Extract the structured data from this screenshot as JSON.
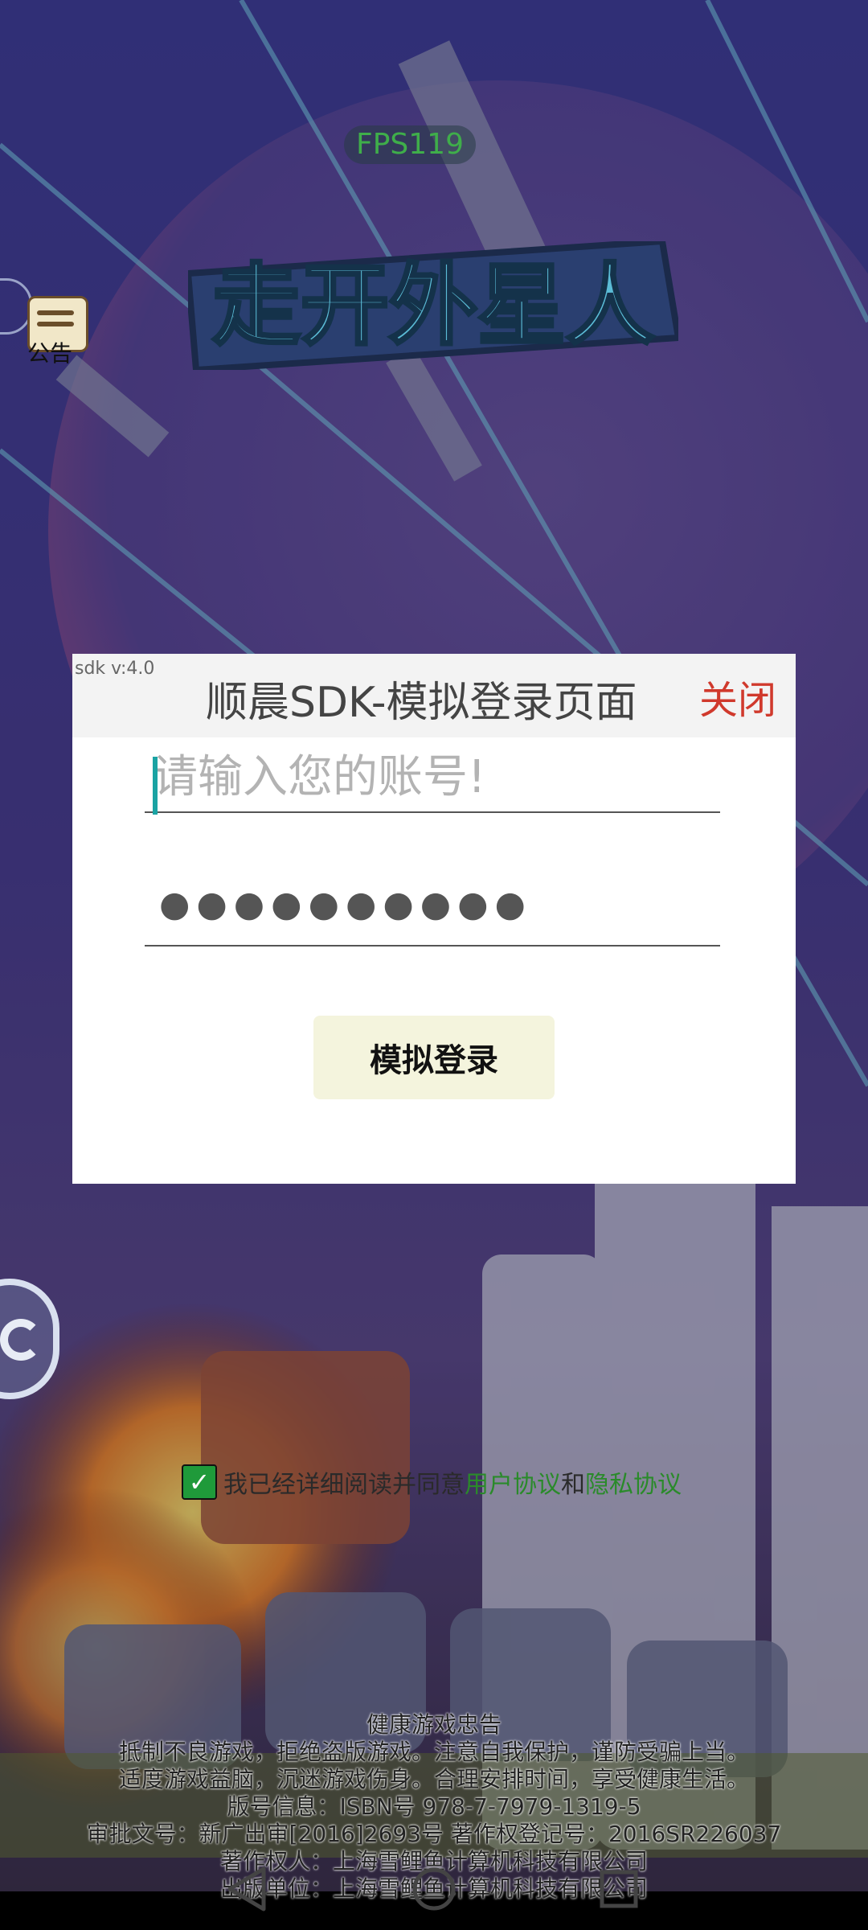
{
  "hud": {
    "fps": "FPS119"
  },
  "game": {
    "title": "走开外星人",
    "notice_label": "公告"
  },
  "dialog": {
    "sdk_version": "sdk v:4.0",
    "title": "顺晨SDK-模拟登录页面",
    "close_label": "关闭",
    "account_placeholder": "请输入您的账号!",
    "password_mask": "●●●●●●●●●●",
    "login_label": "模拟登录"
  },
  "agreement": {
    "checked": true,
    "text": "我已经详细阅读并同意",
    "user_agreement": "用户协议",
    "and": "和",
    "privacy_policy": "隐私协议"
  },
  "footer": {
    "heading": "健康游戏忠告",
    "line1": "抵制不良游戏，拒绝盗版游戏。注意自我保护，谨防受骗上当。",
    "line2": "适度游戏益脑，沉迷游戏伤身。合理安排时间，享受健康生活。",
    "line3": "版号信息：ISBN号 978-7-7979-1319-5",
    "line4": "审批文号：新广出审[2016]2693号  著作权登记号：2016SR226037",
    "line5": "著作权人：上海雪鲤鱼计算机科技有限公司",
    "line6": "出版单位：上海雪鲤鱼计算机科技有限公司"
  },
  "navbar": {
    "back_icon": "back-triangle-icon",
    "home_icon": "home-circle-icon",
    "recents_icon": "recents-square-icon"
  }
}
